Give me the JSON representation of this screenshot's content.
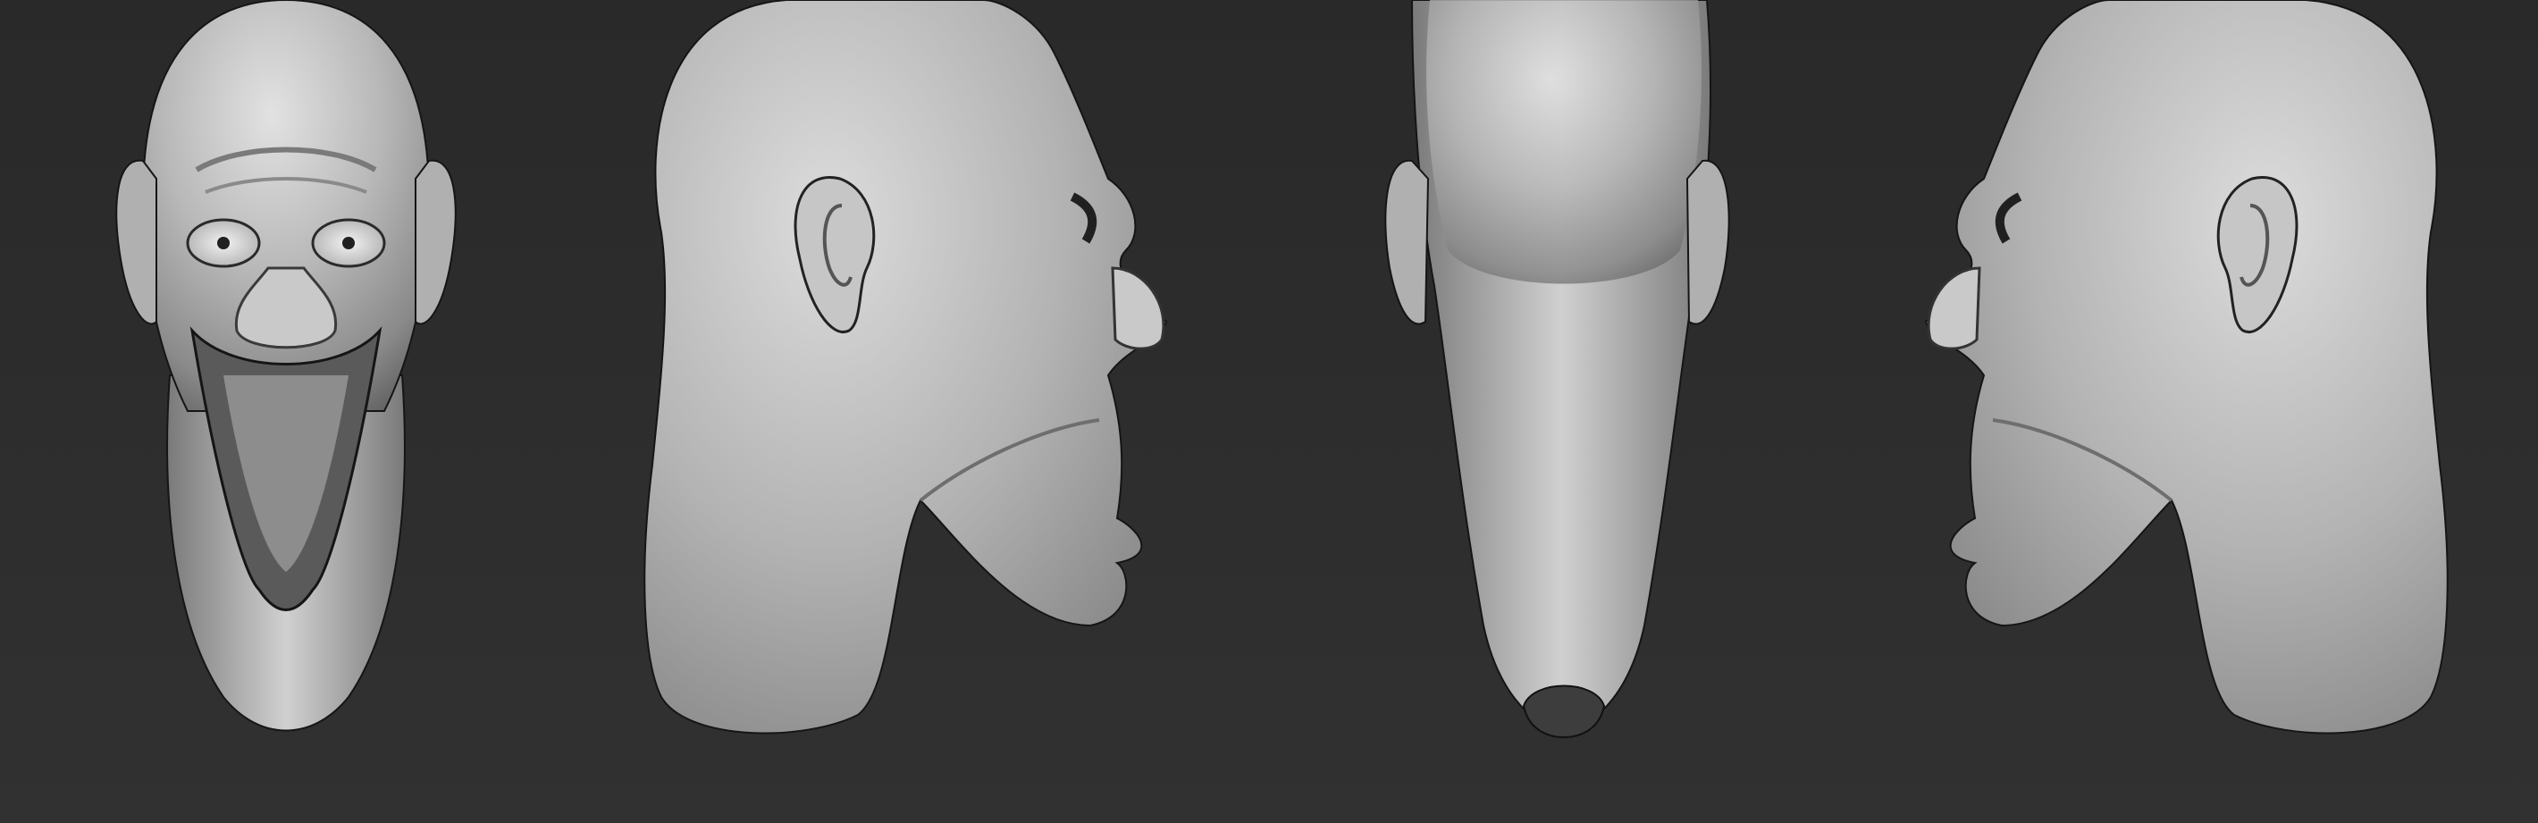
{
  "canvas": {
    "background_top": "#2a2a2a",
    "background_bottom": "#303030"
  },
  "views": [
    {
      "id": "front",
      "name": "front-view"
    },
    {
      "id": "right",
      "name": "right-profile-view"
    },
    {
      "id": "back",
      "name": "back-view"
    },
    {
      "id": "left",
      "name": "left-profile-view"
    }
  ],
  "material": {
    "highlight": "#d9d9d9",
    "mid": "#a6a6a6",
    "shadow": "#4a4a4a",
    "edge": "#151515"
  }
}
